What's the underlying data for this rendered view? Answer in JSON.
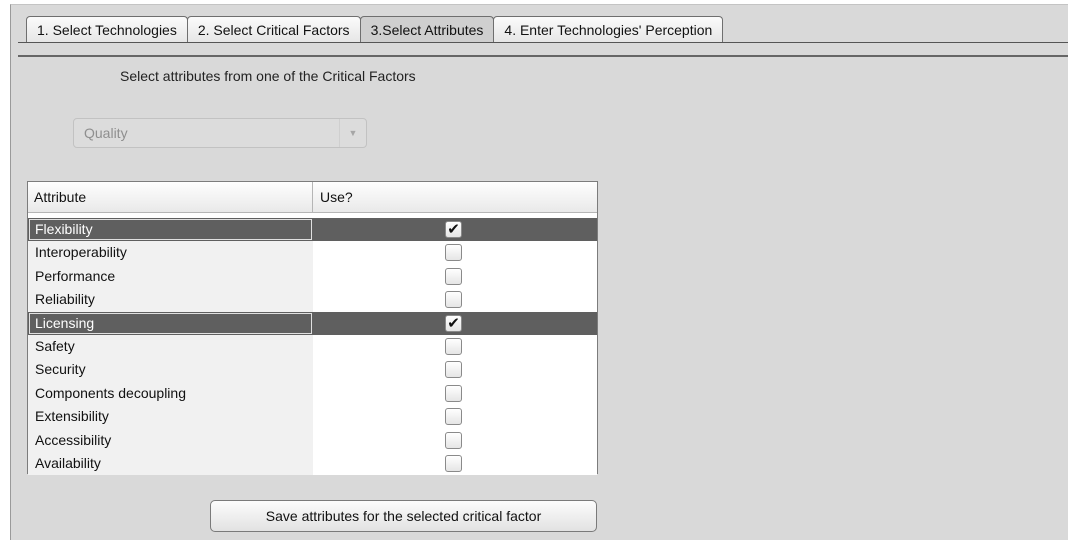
{
  "tabs": [
    {
      "label": "1. Select Technologies",
      "active": false
    },
    {
      "label": "2. Select Critical Factors",
      "active": false
    },
    {
      "label": "3.Select Attributes",
      "active": true
    },
    {
      "label": "4. Enter Technologies' Perception",
      "active": false
    }
  ],
  "instruction": "Select  attributes from one of the Critical Factors",
  "critical_factor_select": {
    "value": "Quality"
  },
  "table": {
    "columns": [
      "Attribute",
      "Use?"
    ],
    "rows": [
      {
        "attribute": "Flexibility",
        "use": true,
        "selected": true
      },
      {
        "attribute": "Interoperability",
        "use": false,
        "selected": false
      },
      {
        "attribute": "Performance",
        "use": false,
        "selected": false
      },
      {
        "attribute": "Reliability",
        "use": false,
        "selected": false
      },
      {
        "attribute": "Licensing",
        "use": true,
        "selected": true
      },
      {
        "attribute": "Safety",
        "use": false,
        "selected": false
      },
      {
        "attribute": "Security",
        "use": false,
        "selected": false
      },
      {
        "attribute": "Components decoupling",
        "use": false,
        "selected": false
      },
      {
        "attribute": "Extensibility",
        "use": false,
        "selected": false
      },
      {
        "attribute": "Accessibility",
        "use": false,
        "selected": false
      },
      {
        "attribute": "Availability",
        "use": false,
        "selected": false
      }
    ]
  },
  "save_button_label": "Save  attributes for the selected critical factor",
  "colors": {
    "background": "#d9d9d9",
    "selected_row": "#5f5f5f"
  }
}
